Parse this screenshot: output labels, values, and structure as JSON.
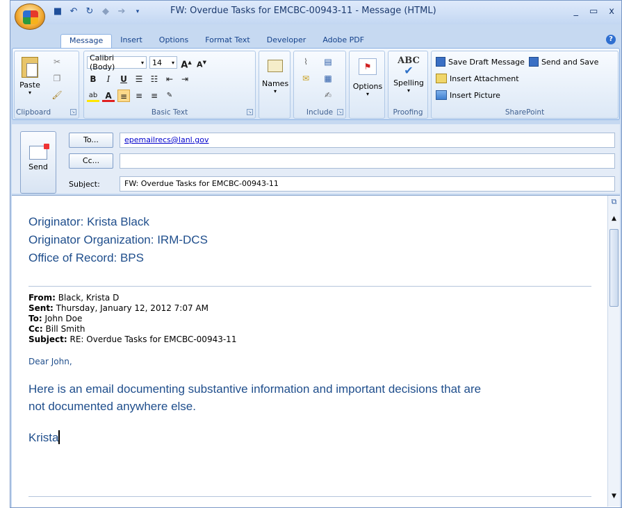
{
  "window": {
    "title": "FW: Overdue Tasks for EMCBC-00943-11 - Message (HTML)"
  },
  "tabs": [
    "Message",
    "Insert",
    "Options",
    "Format Text",
    "Developer",
    "Adobe PDF"
  ],
  "ribbon": {
    "clipboard": {
      "paste_label": "Paste",
      "group_label": "Clipboard"
    },
    "basic_text": {
      "font_name": "Calibri (Body)",
      "font_size": "14",
      "group_label": "Basic Text",
      "bold": "B",
      "italic": "I",
      "underline": "U",
      "grow": "A",
      "shrink": "A"
    },
    "names": {
      "label": "Names"
    },
    "include": {
      "group_label": "Include"
    },
    "options": {
      "label": "Options"
    },
    "proofing": {
      "abc": "ABC",
      "spelling_label": "Spelling",
      "group_label": "Proofing"
    },
    "sharepoint": {
      "save_draft": "Save Draft Message",
      "send_and_save": "Send and Save",
      "insert_attachment": "Insert Attachment",
      "insert_picture": "Insert Picture",
      "group_label": "SharePoint"
    }
  },
  "header": {
    "send_label": "Send",
    "to_label": "To...",
    "cc_label": "Cc...",
    "subject_label": "Subject:",
    "to_value": "epemailrecs@lanl.gov",
    "cc_value": "",
    "subject_value": "FW: Overdue Tasks for EMCBC-00943-11"
  },
  "body": {
    "originator": "Originator: Krista Black",
    "organization": "Originator Organization: IRM-DCS",
    "office": "Office of Record: BPS",
    "from_label": "From:",
    "from_value": " Black, Krista D",
    "sent_label": "Sent:",
    "sent_value": " Thursday, January 12, 2012 7:07 AM",
    "to_label": "To:",
    "to_value": " John Doe",
    "cc_label": "Cc:",
    "cc_value": " Bill Smith",
    "subject_label": "Subject:",
    "subject_value": " RE: Overdue Tasks for EMCBC-00943-11",
    "greeting": "Dear John,",
    "paragraph_line1": "Here is an email documenting substantive information and important decisions that are",
    "paragraph_line2": "not documented anywhere else.",
    "signature": "Krista"
  },
  "colors": {
    "body_text_blue": "#1f4e8c",
    "ribbon_bg": "#d7e5f6",
    "link_blue": "#0000cc"
  }
}
